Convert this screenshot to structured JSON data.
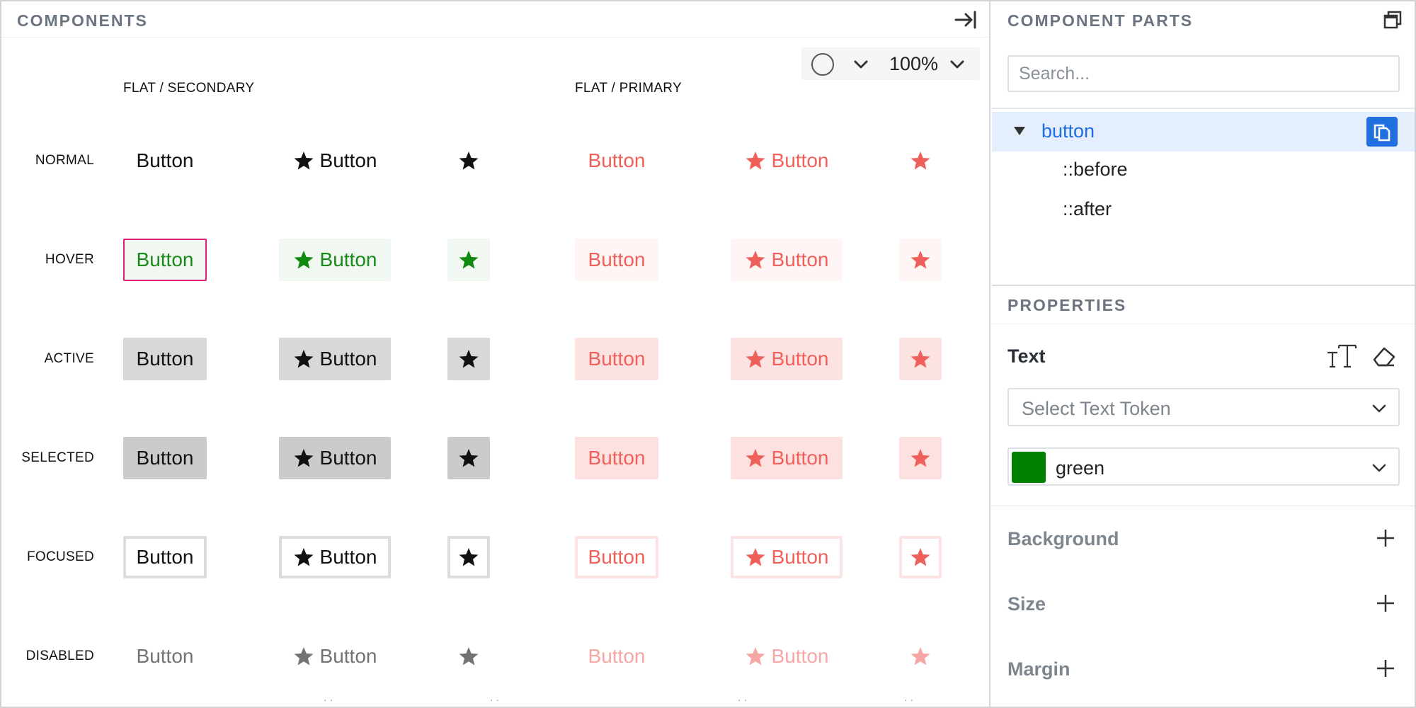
{
  "components_panel": {
    "title": "COMPONENTS",
    "zoom": "100%",
    "columns": {
      "secondary": "FLAT / SECONDARY",
      "primary": "FLAT / PRIMARY"
    },
    "rows": [
      "NORMAL",
      "HOVER",
      "ACTIVE",
      "SELECTED",
      "FOCUSED",
      "DISABLED"
    ],
    "button_label": "Button",
    "variants": [
      "text",
      "icon+text",
      "icon-only"
    ],
    "hover_outline_color": "#e0217a",
    "secondary_hover_color": "#1a8a1a",
    "primary_color": "#f0605a",
    "icon": "star-icon"
  },
  "parts_panel": {
    "title": "COMPONENT PARTS",
    "search_placeholder": "Search...",
    "tree": {
      "root": "button",
      "children": [
        "::before",
        "::after"
      ]
    }
  },
  "properties_panel": {
    "title": "PROPERTIES",
    "text_label": "Text",
    "text_token_placeholder": "Select Text Token",
    "color_value": "green",
    "color_swatch": "#008000",
    "sections": [
      "Background",
      "Size",
      "Margin"
    ]
  }
}
